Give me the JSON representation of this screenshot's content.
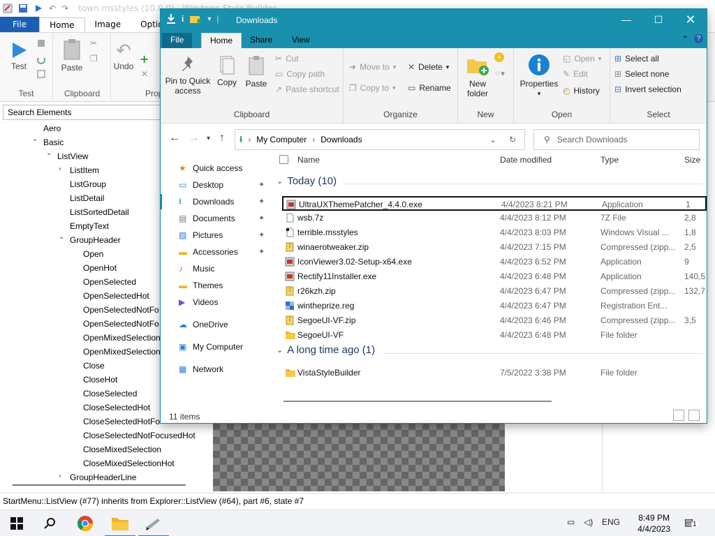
{
  "bgapp": {
    "title": "town.msstyles (10.0.0) - Windows Style Builder",
    "tabs": [
      "File",
      "Home",
      "Image",
      "Options"
    ],
    "ribbon": {
      "test_label": "Test",
      "test_group": "Test",
      "paste_label": "Paste",
      "clipboard_group": "Clipboard",
      "undo_label": "Undo",
      "prop_group": "Prope"
    },
    "search_placeholder": "Search Elements",
    "tree": [
      {
        "label": "Aero",
        "level": 0,
        "arrow": ""
      },
      {
        "label": "Basic",
        "level": 0,
        "arrow": "down"
      },
      {
        "label": "ListView",
        "level": 1,
        "arrow": "down"
      },
      {
        "label": "ListItem",
        "level": 2,
        "arrow": "right"
      },
      {
        "label": "ListGroup",
        "level": 2,
        "arrow": ""
      },
      {
        "label": "ListDetail",
        "level": 2,
        "arrow": ""
      },
      {
        "label": "ListSortedDetail",
        "level": 2,
        "arrow": ""
      },
      {
        "label": "EmptyText",
        "level": 2,
        "arrow": ""
      },
      {
        "label": "GroupHeader",
        "level": 2,
        "arrow": "down"
      },
      {
        "label": "Open",
        "level": 3,
        "arrow": ""
      },
      {
        "label": "OpenHot",
        "level": 3,
        "arrow": ""
      },
      {
        "label": "OpenSelected",
        "level": 3,
        "arrow": ""
      },
      {
        "label": "OpenSelectedHot",
        "level": 3,
        "arrow": ""
      },
      {
        "label": "OpenSelectedNotFo",
        "level": 3,
        "arrow": ""
      },
      {
        "label": "OpenSelectedNotFo",
        "level": 3,
        "arrow": ""
      },
      {
        "label": "OpenMixedSelection",
        "level": 3,
        "arrow": ""
      },
      {
        "label": "OpenMixedSelection",
        "level": 3,
        "arrow": ""
      },
      {
        "label": "Close",
        "level": 3,
        "arrow": ""
      },
      {
        "label": "CloseHot",
        "level": 3,
        "arrow": ""
      },
      {
        "label": "CloseSelected",
        "level": 3,
        "arrow": ""
      },
      {
        "label": "CloseSelectedHot",
        "level": 3,
        "arrow": ""
      },
      {
        "label": "CloseSelectedHotFo",
        "level": 3,
        "arrow": ""
      },
      {
        "label": "CloseSelectedNotFocusedHot",
        "level": 3,
        "arrow": ""
      },
      {
        "label": "CloseMixedSelection",
        "level": 3,
        "arrow": ""
      },
      {
        "label": "CloseMixedSelectionHot",
        "level": 3,
        "arrow": ""
      },
      {
        "label": "GroupHeaderLine",
        "level": 2,
        "arrow": "right"
      }
    ],
    "status_text": "StartMenu::ListView (#77) inherits from Explorer::ListView (#64), part #6, state #7"
  },
  "explorer": {
    "title": "Downloads",
    "tabs": {
      "file": "File",
      "home": "Home",
      "share": "Share",
      "view": "View"
    },
    "ribbon": {
      "pin_label": "Pin to Quick access",
      "copy_label": "Copy",
      "paste_label": "Paste",
      "cut_label": "Cut",
      "copy_path_label": "Copy path",
      "paste_shortcut_label": "Paste shortcut",
      "clipboard_group": "Clipboard",
      "move_to_label": "Move to",
      "copy_to_label": "Copy to",
      "delete_label": "Delete",
      "rename_label": "Rename",
      "organize_group": "Organize",
      "new_folder_label": "New folder",
      "new_group": "New",
      "properties_label": "Properties",
      "open_label": "Open",
      "edit_label": "Edit",
      "history_label": "History",
      "open_group": "Open",
      "select_all_label": "Select all",
      "select_none_label": "Select none",
      "invert_selection_label": "Invert selection",
      "select_group": "Select"
    },
    "address": {
      "crumb1": "My Computer",
      "crumb2": "Downloads"
    },
    "search_placeholder": "Search Downloads",
    "nav": [
      {
        "label": "Quick access",
        "pinned": false
      },
      {
        "label": "Desktop",
        "pinned": true
      },
      {
        "label": "Downloads",
        "pinned": true
      },
      {
        "label": "Documents",
        "pinned": true
      },
      {
        "label": "Pictures",
        "pinned": true
      },
      {
        "label": "Accessories",
        "pinned": true
      },
      {
        "label": "Music",
        "pinned": false
      },
      {
        "label": "Themes",
        "pinned": false
      },
      {
        "label": "Videos",
        "pinned": false
      },
      {
        "label": "OneDrive",
        "pinned": false
      },
      {
        "label": "My Computer",
        "pinned": false
      },
      {
        "label": "Network",
        "pinned": false
      }
    ],
    "columns": {
      "name": "Name",
      "date": "Date modified",
      "type": "Type",
      "size": "Size"
    },
    "group_today": "Today (10)",
    "group_older": "A long time ago (1)",
    "files": [
      {
        "name": "UltraUXThemePatcher_4.4.0.exe",
        "date": "4/4/2023 8:21 PM",
        "type": "Application",
        "size": "1",
        "icon": "exe-icon"
      },
      {
        "name": "wsb.7z",
        "date": "4/4/2023 8:12 PM",
        "type": "7Z File",
        "size": "2,8",
        "icon": "file-icon"
      },
      {
        "name": "terrible.msstyles",
        "date": "4/4/2023 8:03 PM",
        "type": "Windows Visual ...",
        "size": "1,8",
        "icon": "msstyles-icon"
      },
      {
        "name": "winaerotweaker.zip",
        "date": "4/4/2023 7:15 PM",
        "type": "Compressed (zipp...",
        "size": "2,5",
        "icon": "zip-icon"
      },
      {
        "name": "IconViewer3.02-Setup-x64.exe",
        "date": "4/4/2023 6:52 PM",
        "type": "Application",
        "size": "9",
        "icon": "exe-icon"
      },
      {
        "name": "Rectify11Installer.exe",
        "date": "4/4/2023 6:48 PM",
        "type": "Application",
        "size": "140,5",
        "icon": "exe-icon"
      },
      {
        "name": "r26kzh.zip",
        "date": "4/4/2023 6:47 PM",
        "type": "Compressed (zipp...",
        "size": "132,7",
        "icon": "zip-icon"
      },
      {
        "name": "wintheprize.reg",
        "date": "4/4/2023 6:47 PM",
        "type": "Registration Ent...",
        "size": "",
        "icon": "reg-icon"
      },
      {
        "name": "SegoeUI-VF.zip",
        "date": "4/4/2023 6:46 PM",
        "type": "Compressed (zipp...",
        "size": "3,5",
        "icon": "zip-icon"
      },
      {
        "name": "SegoeUI-VF",
        "date": "4/4/2023 6:48 PM",
        "type": "File folder",
        "size": "",
        "icon": "folder-icon"
      }
    ],
    "older_files": [
      {
        "name": "VistaStyleBuilder",
        "date": "7/5/2022 3:38 PM",
        "type": "File folder",
        "size": "",
        "icon": "folder-icon"
      }
    ],
    "status": "11 items"
  },
  "taskbar": {
    "language": "ENG",
    "time": "8:49 PM",
    "date": "4/4/2023",
    "notifications": "1"
  },
  "colors": {
    "titlebar": "#1990ad",
    "file_tab": "#1a5fb4",
    "selection_border": "#111111"
  }
}
